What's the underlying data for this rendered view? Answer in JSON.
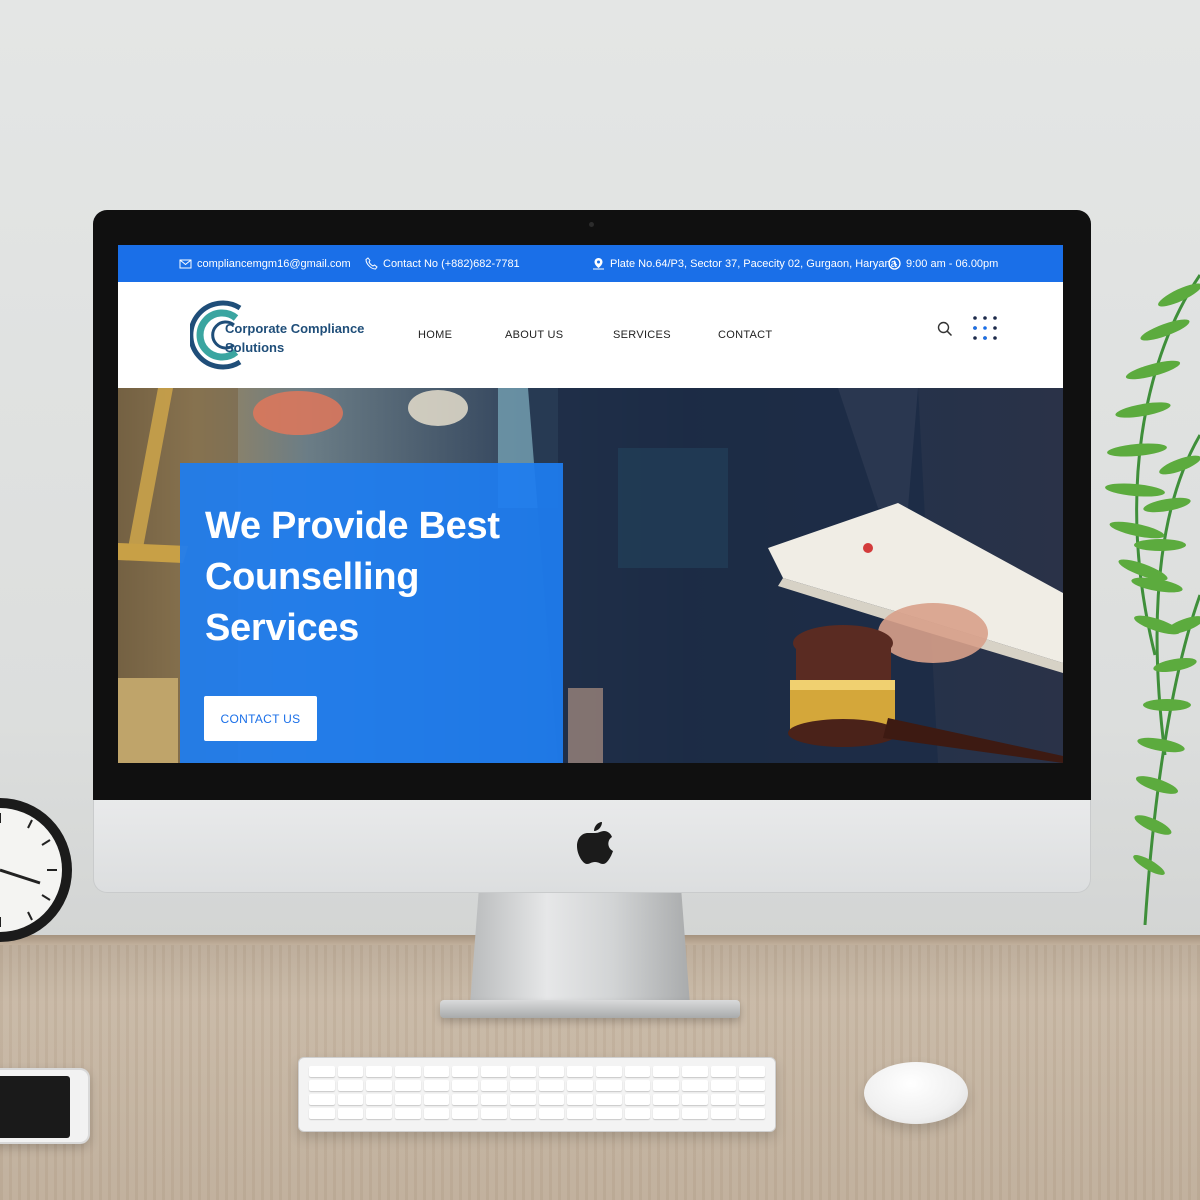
{
  "topbar": {
    "email": "compliancemgm16@gmail.com",
    "phone": "Contact No (+882)682-7781",
    "address": "Plate No.64/P3, Sector 37, Pacecity 02, Gurgaon, Haryana",
    "hours": "9:00 am - 06.00pm",
    "icons": [
      "mail-icon",
      "phone-icon",
      "location-icon",
      "clock-icon"
    ]
  },
  "logo": {
    "line1": "Corporate Compliance",
    "line2": "Solutions"
  },
  "menu": {
    "items": [
      {
        "label": "HOME"
      },
      {
        "label": "ABOUT US"
      },
      {
        "label": "SERVICES"
      },
      {
        "label": "CONTACT"
      }
    ]
  },
  "hero": {
    "title_line1": "We Provide Best",
    "title_line2": "Counselling",
    "title_line3": "Services",
    "cta_label": "CONTACT US"
  },
  "colors": {
    "brand_blue": "#1a6fe8",
    "hero_box": "#1e7df0",
    "logo_text": "#1f4e79"
  }
}
